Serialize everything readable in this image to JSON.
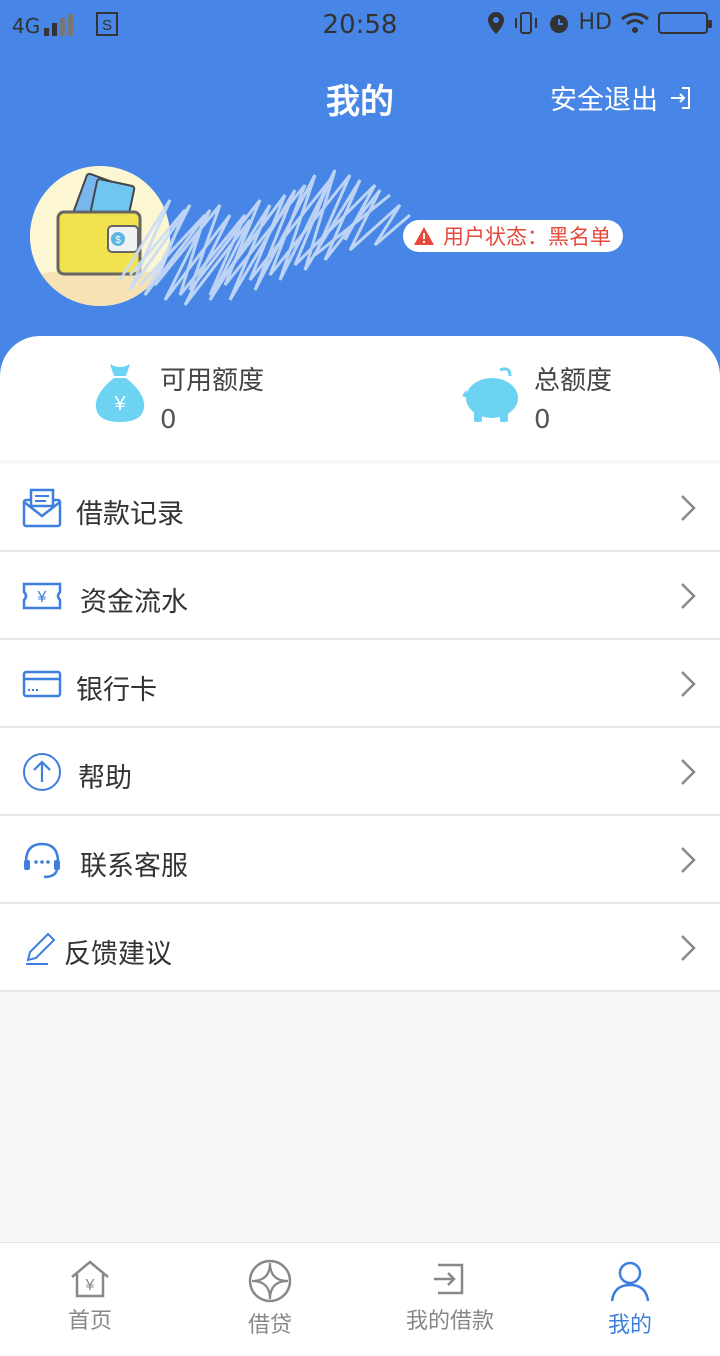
{
  "status_bar": {
    "network": "4G",
    "time": "20:58",
    "hd": "HD"
  },
  "header": {
    "title": "我的",
    "logout_label": "安全退出",
    "user_status": "用户状态：黑名单"
  },
  "balance": {
    "available_label": "可用额度",
    "available_value": "0",
    "total_label": "总额度",
    "total_value": "0"
  },
  "menu": {
    "items": [
      {
        "label": "借款记录",
        "icon": "envelope-icon"
      },
      {
        "label": "资金流水",
        "icon": "yen-ticket-icon"
      },
      {
        "label": "银行卡",
        "icon": "bank-card-icon"
      },
      {
        "label": "帮助",
        "icon": "arrow-up-circle-icon"
      },
      {
        "label": "联系客服",
        "icon": "headset-icon"
      },
      {
        "label": "反馈建议",
        "icon": "pencil-icon"
      }
    ]
  },
  "nav": {
    "items": [
      {
        "label": "首页",
        "icon": "home-yen-icon"
      },
      {
        "label": "借贷",
        "icon": "loan-circle-icon"
      },
      {
        "label": "我的借款",
        "icon": "my-loan-icon"
      },
      {
        "label": "我的",
        "icon": "user-icon"
      }
    ]
  },
  "colors": {
    "header_bg": "#4786e6",
    "accent": "#3d7fde",
    "warning": "#e64a3b",
    "icon_cyan": "#6dd3f2"
  }
}
